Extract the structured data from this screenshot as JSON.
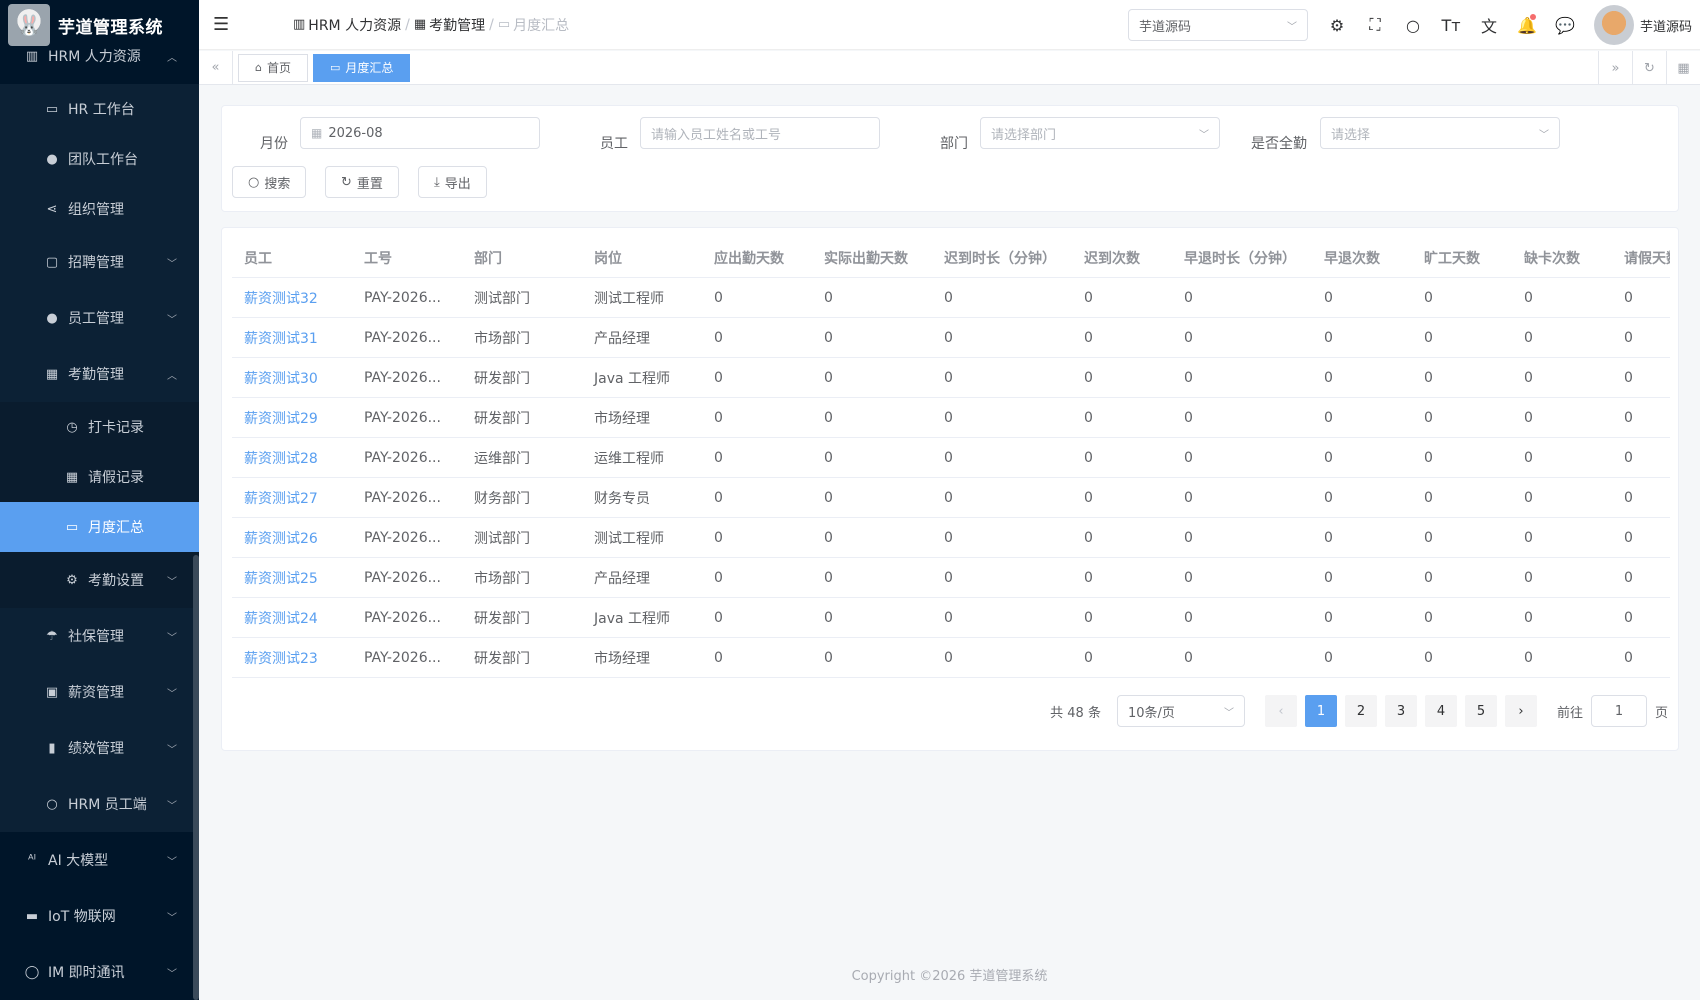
{
  "app": {
    "title": "芋道管理系统",
    "logo_icon": "rabbit-logo-icon"
  },
  "sidebar": {
    "top_item": {
      "label": "HRM 人力资源",
      "icon": "building-icon"
    },
    "hrm_items": [
      {
        "label": "HR 工作台",
        "icon": "monitor-icon"
      },
      {
        "label": "团队工作台",
        "icon": "user-icon"
      },
      {
        "label": "组织管理",
        "icon": "share-icon"
      },
      {
        "label": "招聘管理",
        "icon": "briefcase-icon"
      },
      {
        "label": "员工管理",
        "icon": "user-icon"
      },
      {
        "label": "考勤管理",
        "icon": "calendar-icon"
      }
    ],
    "attendance_items": [
      {
        "label": "打卡记录",
        "icon": "clock-icon"
      },
      {
        "label": "请假记录",
        "icon": "calendar-icon"
      },
      {
        "label": "月度汇总",
        "icon": "monitor-icon"
      },
      {
        "label": "考勤设置",
        "icon": "gear-icon"
      }
    ],
    "hrm_more": [
      {
        "label": "社保管理",
        "icon": "umbrella-icon"
      },
      {
        "label": "薪资管理",
        "icon": "money-icon"
      },
      {
        "label": "绩效管理",
        "icon": "bar-chart-icon"
      },
      {
        "label": "HRM 员工端",
        "icon": "user-icon"
      }
    ],
    "root_items": [
      {
        "label": "AI 大模型",
        "icon": "ai-icon"
      },
      {
        "label": "IoT 物联网",
        "icon": "car-icon"
      },
      {
        "label": "IM 即时通讯",
        "icon": "chat-icon"
      }
    ]
  },
  "header": {
    "breadcrumb": [
      "HRM 人力资源",
      "考勤管理",
      "月度汇总"
    ],
    "tenant": "芋道源码",
    "username": "芋道源码"
  },
  "tabs": [
    {
      "label": "首页"
    },
    {
      "label": "月度汇总"
    }
  ],
  "search": {
    "month_label": "月份",
    "month_value": "2026-08",
    "employee_label": "员工",
    "employee_placeholder": "请输入员工姓名或工号",
    "dept_label": "部门",
    "dept_placeholder": "请选择部门",
    "full_label": "是否全勤",
    "full_placeholder": "请选择",
    "search_btn": "搜索",
    "reset_btn": "重置",
    "export_btn": "导出"
  },
  "table": {
    "columns": [
      "员工",
      "工号",
      "部门",
      "岗位",
      "应出勤天数",
      "实际出勤天数",
      "迟到时长（分钟）",
      "迟到次数",
      "早退时长（分钟）",
      "早退次数",
      "旷工天数",
      "缺卡次数",
      "请假天数"
    ],
    "rows": [
      [
        "薪资测试32",
        "PAY-2026...",
        "测试部门",
        "测试工程师",
        "0",
        "0",
        "0",
        "0",
        "0",
        "0",
        "0",
        "0",
        "0"
      ],
      [
        "薪资测试31",
        "PAY-2026...",
        "市场部门",
        "产品经理",
        "0",
        "0",
        "0",
        "0",
        "0",
        "0",
        "0",
        "0",
        "0"
      ],
      [
        "薪资测试30",
        "PAY-2026...",
        "研发部门",
        "Java 工程师",
        "0",
        "0",
        "0",
        "0",
        "0",
        "0",
        "0",
        "0",
        "0"
      ],
      [
        "薪资测试29",
        "PAY-2026...",
        "研发部门",
        "市场经理",
        "0",
        "0",
        "0",
        "0",
        "0",
        "0",
        "0",
        "0",
        "0"
      ],
      [
        "薪资测试28",
        "PAY-2026...",
        "运维部门",
        "运维工程师",
        "0",
        "0",
        "0",
        "0",
        "0",
        "0",
        "0",
        "0",
        "0"
      ],
      [
        "薪资测试27",
        "PAY-2026...",
        "财务部门",
        "财务专员",
        "0",
        "0",
        "0",
        "0",
        "0",
        "0",
        "0",
        "0",
        "0"
      ],
      [
        "薪资测试26",
        "PAY-2026...",
        "测试部门",
        "测试工程师",
        "0",
        "0",
        "0",
        "0",
        "0",
        "0",
        "0",
        "0",
        "0"
      ],
      [
        "薪资测试25",
        "PAY-2026...",
        "市场部门",
        "产品经理",
        "0",
        "0",
        "0",
        "0",
        "0",
        "0",
        "0",
        "0",
        "0"
      ],
      [
        "薪资测试24",
        "PAY-2026...",
        "研发部门",
        "Java 工程师",
        "0",
        "0",
        "0",
        "0",
        "0",
        "0",
        "0",
        "0",
        "0"
      ],
      [
        "薪资测试23",
        "PAY-2026...",
        "研发部门",
        "市场经理",
        "0",
        "0",
        "0",
        "0",
        "0",
        "0",
        "0",
        "0",
        "0"
      ]
    ]
  },
  "pagination": {
    "total": "共 48 条",
    "page_size": "10条/页",
    "pages": [
      "1",
      "2",
      "3",
      "4",
      "5"
    ],
    "current": "1",
    "goto_label": "前往",
    "goto_value": "1",
    "page_suffix": "页"
  },
  "footer": {
    "copyright": "Copyright ©2026 芋道管理系统"
  },
  "colors": {
    "primary": "#5a9ff0",
    "sidebar_bg": "#001529"
  }
}
